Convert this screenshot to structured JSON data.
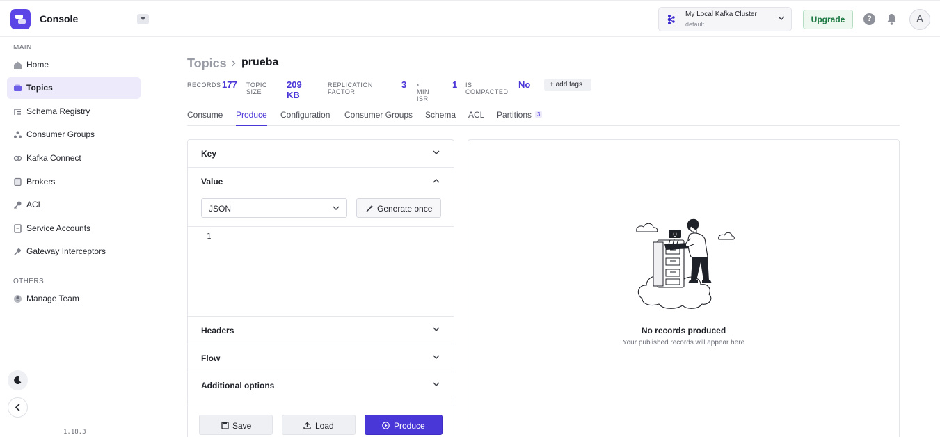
{
  "header": {
    "app_title": "Console",
    "cluster_name": "My Local Kafka Cluster",
    "cluster_env": "default",
    "upgrade_label": "Upgrade",
    "help_label": "?",
    "avatar_initial": "A"
  },
  "sidebar": {
    "main_label": "MAIN",
    "items": [
      {
        "label": "Home",
        "icon": "home-icon"
      },
      {
        "label": "Topics",
        "icon": "topics-icon",
        "active": true
      },
      {
        "label": "Schema Registry",
        "icon": "schema-icon"
      },
      {
        "label": "Consumer Groups",
        "icon": "consumer-groups-icon"
      },
      {
        "label": "Kafka Connect",
        "icon": "connect-icon"
      },
      {
        "label": "Brokers",
        "icon": "brokers-icon"
      },
      {
        "label": "ACL",
        "icon": "key-icon"
      },
      {
        "label": "Service Accounts",
        "icon": "document-icon"
      },
      {
        "label": "Gateway Interceptors",
        "icon": "plug-icon"
      }
    ],
    "others_label": "OTHERS",
    "others_items": [
      {
        "label": "Manage Team",
        "icon": "team-icon"
      }
    ],
    "version": "1.18.3"
  },
  "page": {
    "breadcrumb_parent": "Topics",
    "topic_name": "prueba",
    "stats": [
      {
        "label": "RECORDS",
        "value": "177"
      },
      {
        "label": "TOPIC SIZE",
        "value": "209 KB"
      },
      {
        "label": "REPLICATION FACTOR",
        "value": "3"
      },
      {
        "label": "< MIN ISR",
        "value": "1"
      },
      {
        "label": "IS COMPACTED",
        "value": "No"
      }
    ],
    "add_tags_label": "+ add tags",
    "tabs": [
      {
        "label": "Consume"
      },
      {
        "label": "Produce",
        "active": true
      },
      {
        "label": "Configuration"
      },
      {
        "label": "Consumer Groups"
      },
      {
        "label": "Schema"
      },
      {
        "label": "ACL"
      },
      {
        "label": "Partitions",
        "badge": "3"
      }
    ]
  },
  "produce": {
    "key_label": "Key",
    "value_label": "Value",
    "format_value": "JSON",
    "generate_label": "Generate once",
    "editor_line": "1",
    "headers_label": "Headers",
    "flow_label": "Flow",
    "additional_label": "Additional options",
    "save_label": "Save",
    "load_label": "Load",
    "produce_label": "Produce"
  },
  "results": {
    "empty_title": "No records produced",
    "empty_subtitle": "Your published records will appear here",
    "counter_glyph": "0"
  },
  "colors": {
    "accent": "#4a37d8",
    "active_nav_bg": "#eceafb",
    "upgrade_green": "#1d7a42"
  }
}
